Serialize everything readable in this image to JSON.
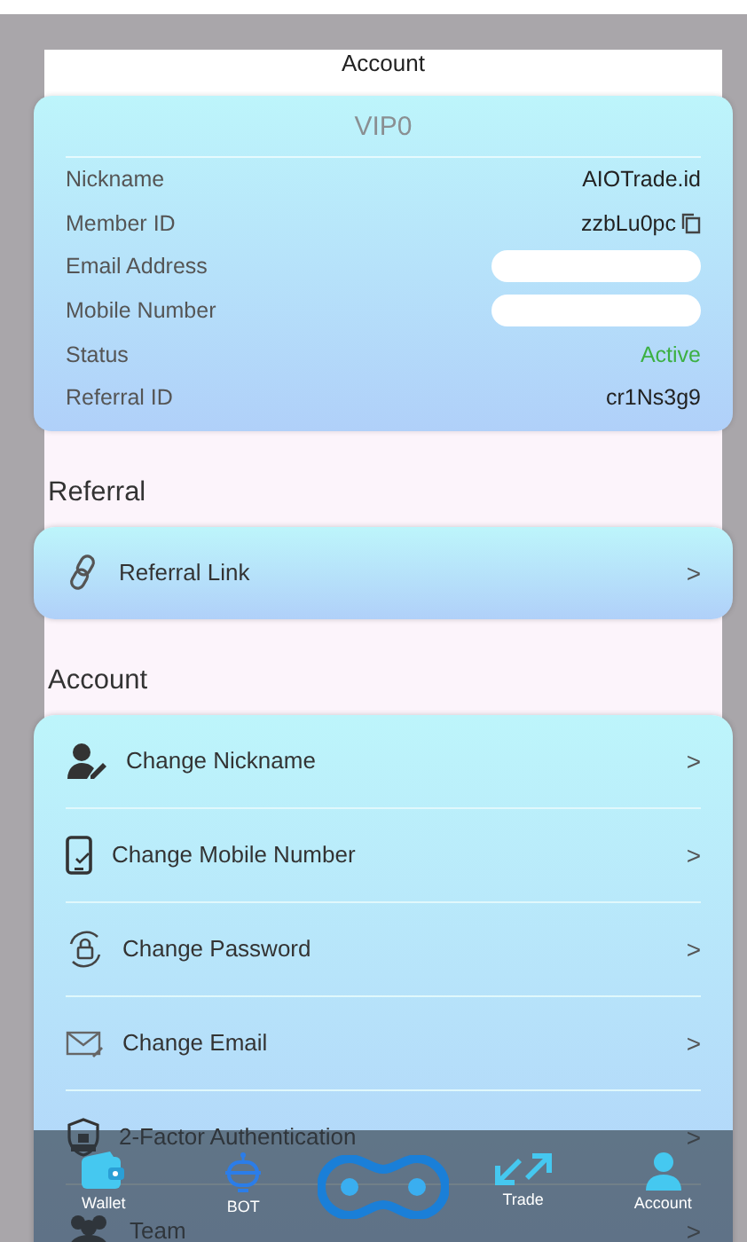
{
  "header": {
    "title": "Account"
  },
  "profile": {
    "level": "VIP0",
    "rows": [
      {
        "label": "Nickname",
        "kind": "text",
        "value": "AIOTrade.id"
      },
      {
        "label": "Member ID",
        "kind": "copy",
        "value": "zzbLu0pc"
      },
      {
        "label": "Email Address",
        "kind": "redacted"
      },
      {
        "label": "Mobile Number",
        "kind": "redacted"
      },
      {
        "label": "Status",
        "kind": "status",
        "value": "Active"
      },
      {
        "label": "Referral ID",
        "kind": "text",
        "value": "cr1Ns3g9"
      }
    ]
  },
  "sections": [
    {
      "title": "Referral",
      "items": [
        {
          "label": "Referral Link"
        }
      ]
    },
    {
      "title": "Account",
      "items": [
        {
          "label": "Change Nickname"
        },
        {
          "label": "Change Mobile Number"
        },
        {
          "label": "Change Password"
        },
        {
          "label": "Change Email"
        },
        {
          "label": "2-Factor Authentication"
        },
        {
          "label": "Team"
        }
      ]
    }
  ],
  "bottom_nav": [
    {
      "label": "Wallet"
    },
    {
      "label": "BOT"
    },
    {
      "kind": "logo"
    },
    {
      "label": "Trade"
    },
    {
      "label": "Account"
    }
  ],
  "chevron": ">"
}
